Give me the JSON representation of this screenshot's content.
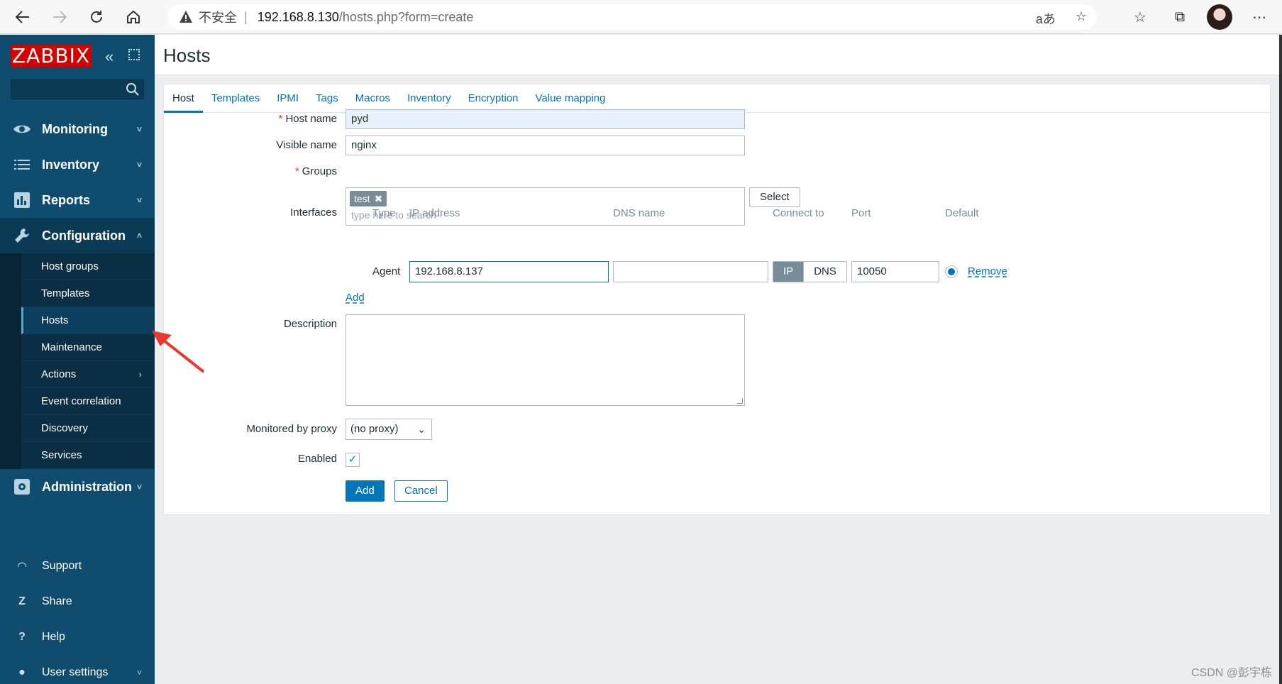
{
  "browser": {
    "insecure_label": "不安全",
    "separator": "|",
    "url_host": "192.168.8.130",
    "url_path": "/hosts.php?form=create",
    "read_aloud": "aあ"
  },
  "sidebar": {
    "logo": "ZABBIX",
    "menu": [
      {
        "label": "Monitoring",
        "icon": "eye-icon",
        "chevron": "˅"
      },
      {
        "label": "Inventory",
        "icon": "list-icon",
        "chevron": "˅"
      },
      {
        "label": "Reports",
        "icon": "bar-chart-icon",
        "chevron": "˅"
      },
      {
        "label": "Configuration",
        "icon": "wrench-icon",
        "chevron": "˄"
      }
    ],
    "submenu": [
      {
        "label": "Host groups"
      },
      {
        "label": "Templates"
      },
      {
        "label": "Hosts"
      },
      {
        "label": "Maintenance"
      },
      {
        "label": "Actions",
        "chevron": "›"
      },
      {
        "label": "Event correlation"
      },
      {
        "label": "Discovery"
      },
      {
        "label": "Services"
      }
    ],
    "administration": {
      "label": "Administration",
      "chevron": "˅"
    },
    "bottom": [
      {
        "label": "Support",
        "icon": "headset-icon",
        "glyph": "◠"
      },
      {
        "label": "Share",
        "icon": "share-icon",
        "glyph": "Z"
      },
      {
        "label": "Help",
        "icon": "help-icon",
        "glyph": "?"
      },
      {
        "label": "User settings",
        "icon": "user-icon",
        "glyph": "●",
        "chevron": "˅"
      }
    ]
  },
  "page": {
    "title": "Hosts"
  },
  "tabs": [
    "Host",
    "Templates",
    "IPMI",
    "Tags",
    "Macros",
    "Inventory",
    "Encryption",
    "Value mapping"
  ],
  "form": {
    "host_name_label": "Host name",
    "host_name_value": "pyd",
    "required_mark": "*",
    "visible_name_label": "Visible name",
    "visible_name_value": "nginx",
    "groups_label": "Groups",
    "group_tag": "test",
    "tag_remove": "✖",
    "groups_placeholder": "type here to search",
    "select_button": "Select",
    "interfaces_label": "Interfaces",
    "interface_headers": {
      "type": "Type",
      "ip": "IP address",
      "dns": "DNS name",
      "connect": "Connect to",
      "port": "Port",
      "default": "Default"
    },
    "interface": {
      "type": "Agent",
      "ip": "192.168.8.137",
      "dns": "",
      "connect_ip": "IP",
      "connect_dns": "DNS",
      "port": "10050",
      "remove": "Remove"
    },
    "add_interface": "Add",
    "description_label": "Description",
    "proxy_label": "Monitored by proxy",
    "proxy_value": "(no proxy)",
    "enabled_label": "Enabled",
    "enabled_check": "✓",
    "add_button": "Add",
    "cancel_button": "Cancel"
  },
  "watermark": "CSDN @彭宇栋",
  "colors": {
    "sidebar": "#0f4c6e",
    "logo": "#d40000",
    "link": "#0275b8",
    "arrow": "#e8382f"
  }
}
